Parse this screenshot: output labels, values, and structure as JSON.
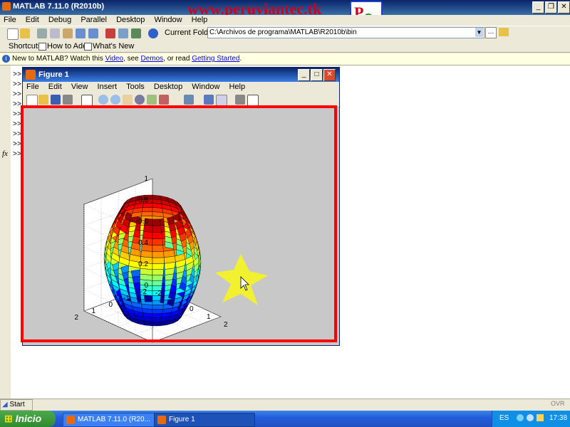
{
  "main_window": {
    "title": "MATLAB 7.11.0 (R2010b)",
    "menu": [
      "File",
      "Edit",
      "Debug",
      "Parallel",
      "Desktop",
      "Window",
      "Help"
    ],
    "current_folder_label": "Current Folder:",
    "current_folder_value": "C:\\Archivos de programa\\MATLAB\\R2010b\\bin",
    "shortcuts_label": "Shortcuts",
    "how_to_add": "How to Add",
    "whats_new": "What's New",
    "info_prefix": "New to MATLAB? Watch this ",
    "info_video": "Video",
    "info_mid": ", see ",
    "info_demos": "Demos",
    "info_mid2": ", or read ",
    "info_getting_started": "Getting Started",
    "info_end": ".",
    "prompt": ">>",
    "fx": "fx",
    "start_button": "Start",
    "ovr": "OVR"
  },
  "watermark": {
    "text": "www.peruviantec.tk",
    "logo_p": "P",
    "logo_c": "C"
  },
  "figure_window": {
    "title": "Figure 1",
    "menu": [
      "File",
      "Edit",
      "View",
      "Insert",
      "Tools",
      "Desktop",
      "Window",
      "Help"
    ]
  },
  "chart_data": {
    "type": "surface",
    "zticks": [
      "1",
      "0.8",
      "0.6",
      "0.4",
      "0.2",
      "0"
    ],
    "yticks": [
      "2",
      "1",
      "0",
      "-1",
      "-2"
    ],
    "xticks": [
      "-2",
      "0",
      "1",
      "2"
    ],
    "zlim": [
      0,
      1
    ],
    "ylim": [
      -2,
      2
    ],
    "xlim": [
      -2,
      2
    ],
    "grid": true
  },
  "taskbar": {
    "start": "Inicio",
    "items": [
      "MATLAB 7.11.0 (R20...",
      "Figure 1"
    ],
    "lang": "ES",
    "clock": "17:38"
  }
}
